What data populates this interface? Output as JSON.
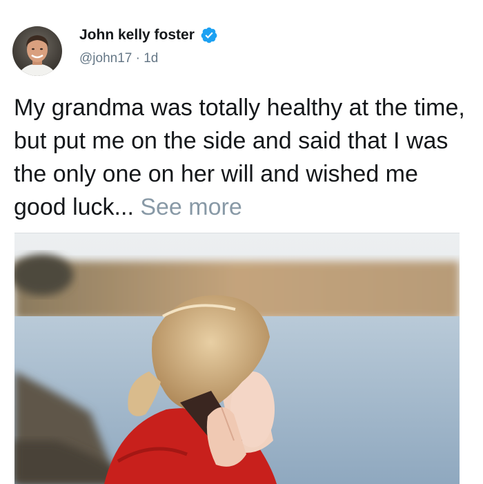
{
  "tweet": {
    "author": {
      "display_name": "John kelly foster",
      "handle": "@john17",
      "separator": "·",
      "time_ago": "1d",
      "verified": true,
      "avatar_icon": "profile-photo"
    },
    "text": "My grandma was totally healthy at the time, but put me on the side and said that I was the only one on her will and wished me good luck...",
    "see_more_label": "See more",
    "media_description_icon": "woman-on-phone-photo"
  },
  "colors": {
    "text": "#14171a",
    "secondary_text": "#657786",
    "see_more": "#8899a6",
    "verified_badge": "#1da1f2"
  }
}
